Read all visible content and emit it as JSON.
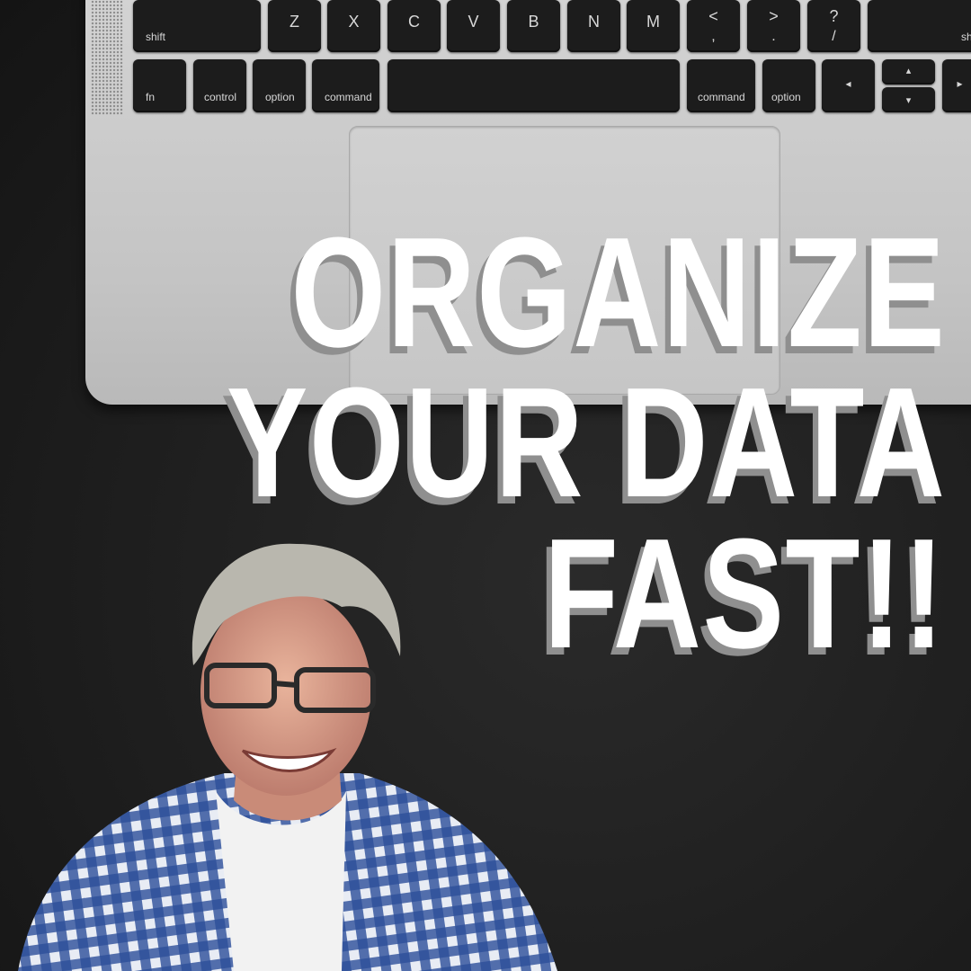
{
  "keyboard": {
    "row1": [
      "shift",
      "Z",
      "X",
      "C",
      "V",
      "B",
      "N",
      "M",
      [
        "<",
        ","
      ],
      [
        ">",
        "."
      ],
      [
        "?",
        "/"
      ],
      "shift"
    ],
    "row2": [
      "fn",
      "control",
      "option",
      "command",
      "",
      "command",
      "option",
      "◂",
      [
        "▴",
        "▾"
      ],
      "▸"
    ]
  },
  "headline": {
    "line1": "ORGANIZE",
    "line2": "YOUR DATA",
    "line3": "FAST!!"
  },
  "colors": {
    "text": "#ffffff",
    "text_shadow": "#8f8f8f",
    "background": "#1d1d1d",
    "laptop": "#c8c8c8",
    "shirt": "#2d4f9a"
  }
}
